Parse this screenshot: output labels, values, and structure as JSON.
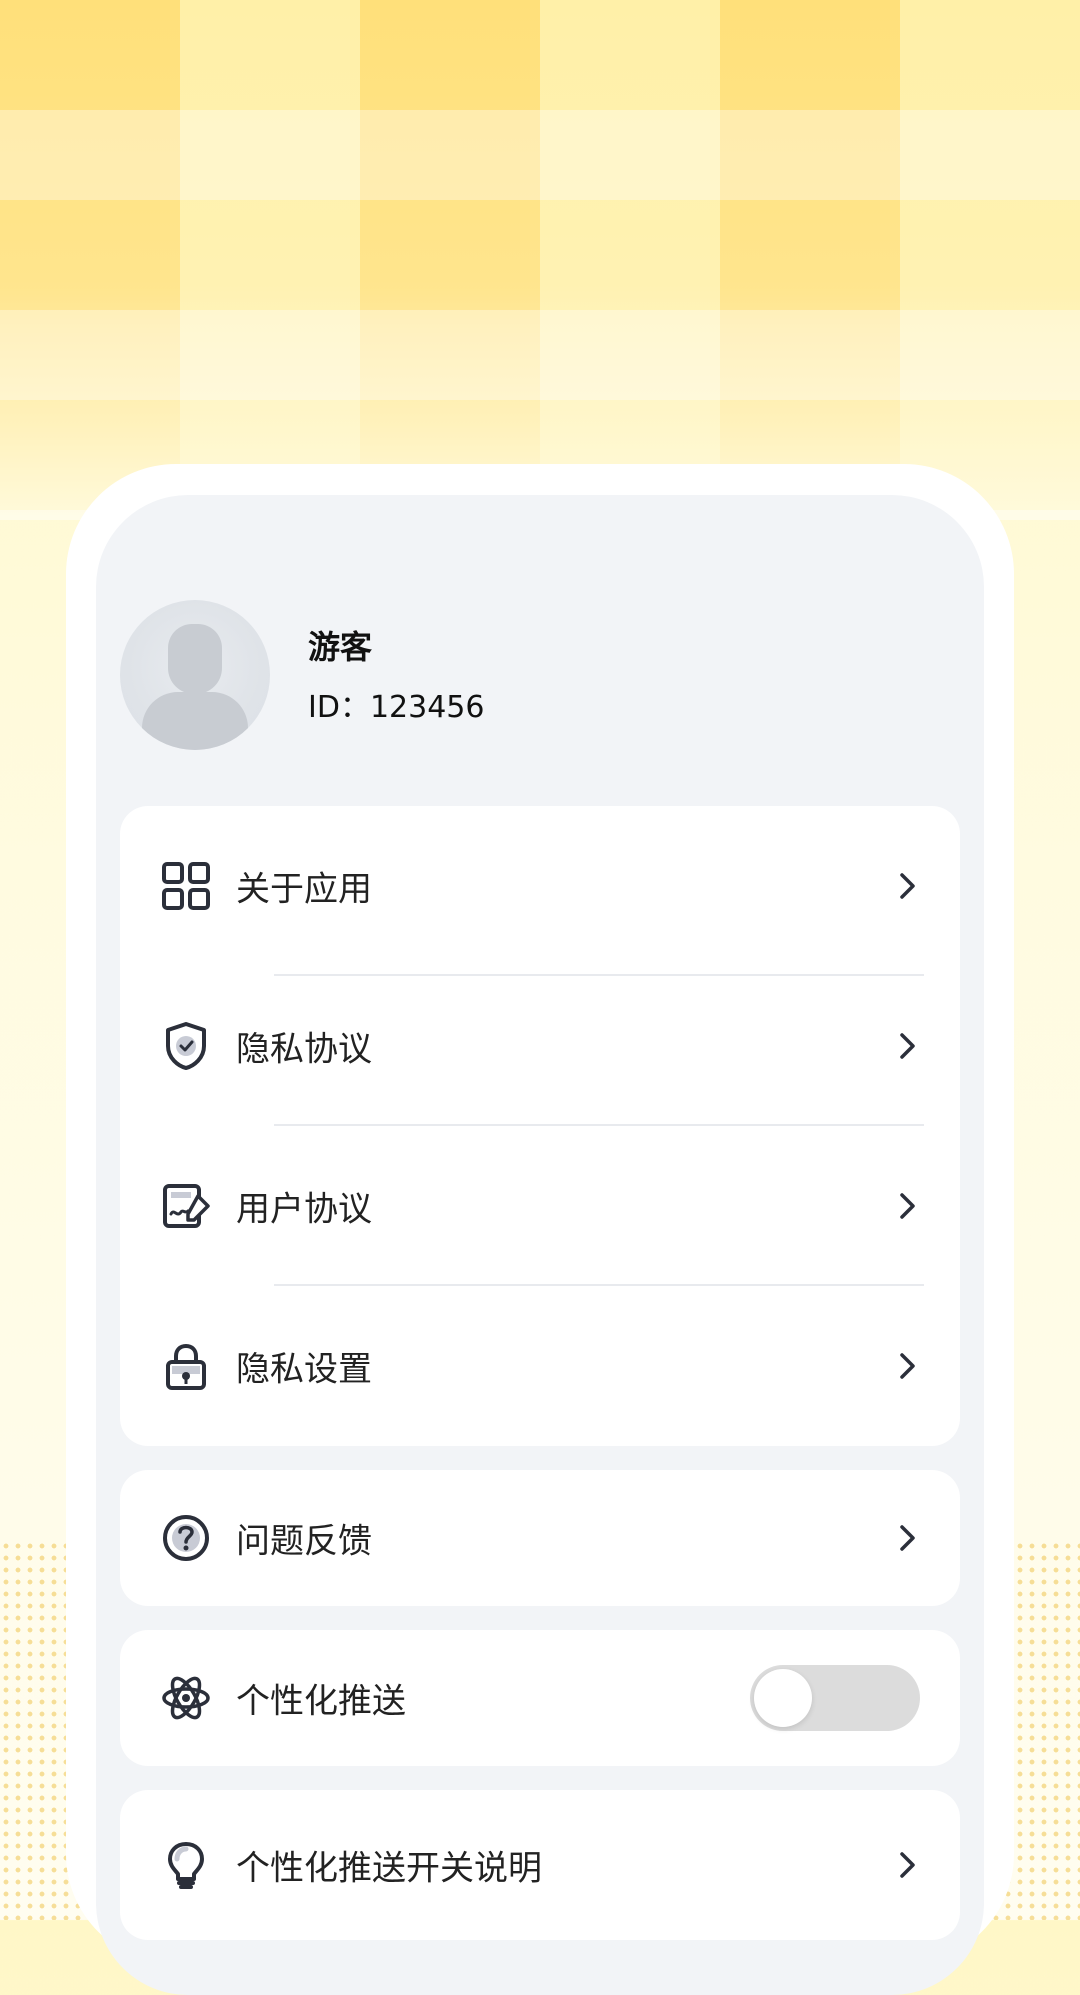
{
  "profile": {
    "name": "游客",
    "id": "ID：123456"
  },
  "menu": {
    "about_app": "关于应用",
    "privacy_agreement": "隐私协议",
    "user_agreement": "用户协议",
    "privacy_settings": "隐私设置",
    "feedback": "问题反馈",
    "personalized_push": "个性化推送",
    "personalized_push_desc": "个性化推送开关说明"
  },
  "toggle": {
    "personalized_push_enabled": false
  },
  "icons": {
    "about_app": "grid-icon",
    "privacy_agreement": "shield-icon",
    "user_agreement": "signature-icon",
    "privacy_settings": "lock-icon",
    "feedback": "question-icon",
    "personalized_push": "atom-icon",
    "personalized_push_desc": "lightbulb-icon",
    "chevron": "chevron-right-icon"
  },
  "colors": {
    "accent_yellow": "#ffe07a",
    "background": "#fffbe0",
    "card_inner": "#f2f4f7",
    "text": "#222222",
    "toggle_off": "#dcdcdc"
  }
}
